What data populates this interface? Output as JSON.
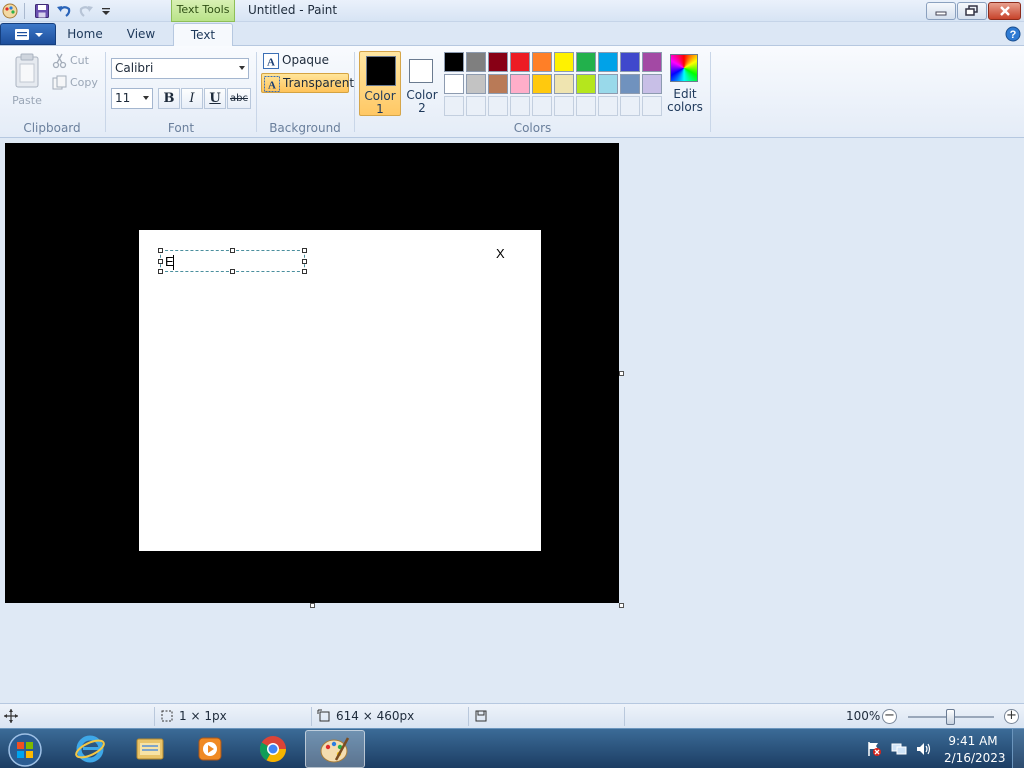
{
  "titlebar": {
    "contextual_tab": "Text Tools",
    "title": "Untitled - Paint"
  },
  "tabs": {
    "home": "Home",
    "view": "View",
    "text": "Text"
  },
  "clipboard": {
    "group_label": "Clipboard",
    "paste": "Paste",
    "cut": "Cut",
    "copy": "Copy"
  },
  "font": {
    "group_label": "Font",
    "family": "Calibri",
    "size": "11",
    "bold": "B",
    "italic": "I",
    "underline": "U",
    "strikethrough": "abc"
  },
  "background": {
    "group_label": "Background",
    "opaque": "Opaque",
    "transparent": "Transparent",
    "selected": "transparent"
  },
  "colors": {
    "group_label": "Colors",
    "color1_label": "Color 1",
    "color2_label": "Color 2",
    "color1": "#000000",
    "color2": "#ffffff",
    "edit_label": "Edit colors",
    "palette_row1": [
      "#000000",
      "#7f7f7f",
      "#880015",
      "#ed1c24",
      "#ff7f27",
      "#fff200",
      "#22b14c",
      "#00a2e8",
      "#3f48cc",
      "#a349a4"
    ],
    "palette_row2": [
      "#ffffff",
      "#c3c3c3",
      "#b97a57",
      "#ffaec9",
      "#ffc90e",
      "#efe4b0",
      "#b5e61d",
      "#99d9ea",
      "#7092be",
      "#c8bfe7"
    ]
  },
  "canvas": {
    "x_mark": "X",
    "text_value": "E"
  },
  "status": {
    "selection_size": "1 × 1px",
    "canvas_size": "614 × 460px",
    "zoom": "100%",
    "zoom_minus": "−",
    "zoom_plus": "+"
  },
  "taskbar": {
    "time": "9:41 AM",
    "date": "2/16/2023"
  }
}
